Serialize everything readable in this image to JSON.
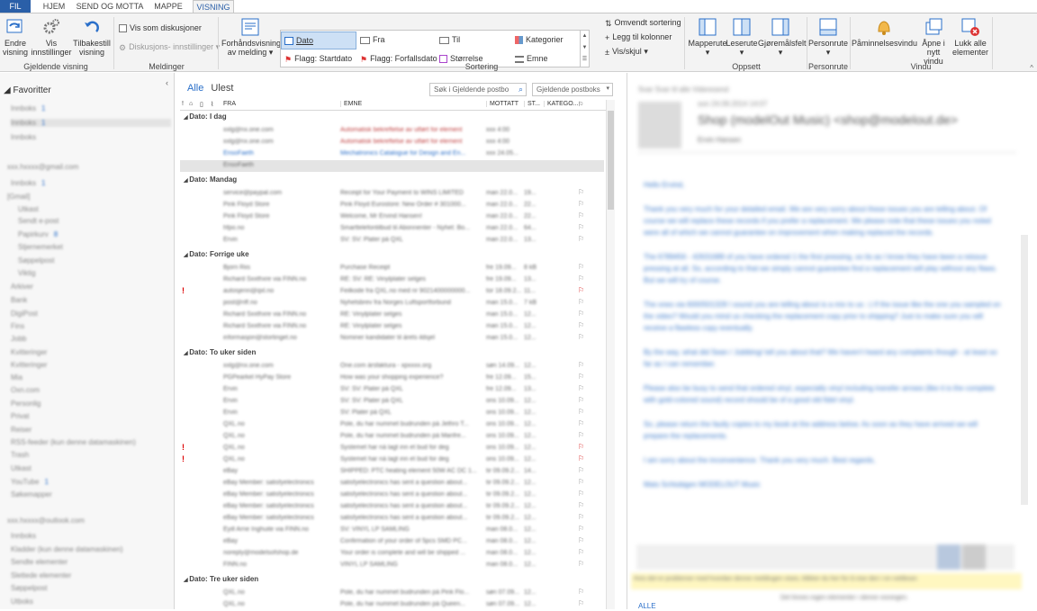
{
  "tabs": [
    "FIL",
    "HJEM",
    "SEND OG MOTTA",
    "MAPPE",
    "VISNING"
  ],
  "ribbon": {
    "change_view": "Endre visning",
    "view_settings": "Vis innstillinger",
    "reset_view": "Tilbakestill visning",
    "current_view_group": "Gjeldende visning",
    "show_conversations": "Vis som diskusjoner",
    "conversation_settings": "Diskusjons- innstillinger",
    "messages_group": "Meldinger",
    "preview": "Forhåndsvisning av melding",
    "arr_date": "Dato",
    "arr_from": "Fra",
    "arr_to": "Til",
    "arr_categories": "Kategorier",
    "arr_flag_start": "Flagg: Startdato",
    "arr_flag_due": "Flagg: Forfallsdato",
    "arr_size": "Størrelse",
    "arr_subject": "Emne",
    "reverse_sort": "Omvendt sortering",
    "add_columns": "Legg til kolonner",
    "expand_collapse": "Vis/skjul",
    "arrangement_group": "Sortering",
    "folder_pane": "Mapperute",
    "reading_pane": "Leserute",
    "todo_bar": "Gjøremålsfelt",
    "layout_group": "Oppsett",
    "people_pane": "Personrute",
    "people_group": "Personrute",
    "reminders": "Påminnelsesvindu",
    "open_new": "Åpne i nytt vindu",
    "close_all": "Lukk alle elementer",
    "window_group": "Vindu"
  },
  "nav": {
    "favorites": "Favoritter",
    "items": [
      {
        "t": "Innboks",
        "c": "1",
        "blue": false
      },
      {
        "t": "Innboks",
        "c": "1",
        "blue": false
      },
      {
        "t": "Innboks",
        "c": "",
        "blue": false
      },
      {
        "t": "xxx.hxxxx@gmail.com",
        "c": "",
        "blue": false
      },
      {
        "t": "Innboks",
        "c": "1",
        "blue": false
      },
      {
        "t": "[Gmail]",
        "c": "",
        "blue": false
      },
      {
        "t": "Utkast",
        "c": "",
        "blue": false
      },
      {
        "t": "Sendt e-post",
        "c": "",
        "blue": false
      },
      {
        "t": "Papirkurv",
        "c": "8",
        "blue": false
      },
      {
        "t": "Stjernemerket",
        "c": "",
        "blue": false
      },
      {
        "t": "Søppelpost",
        "c": "",
        "blue": false
      },
      {
        "t": "Viktig",
        "c": "",
        "blue": false
      },
      {
        "t": "Arkiver",
        "c": "",
        "blue": false
      },
      {
        "t": "Bank",
        "c": "",
        "blue": false
      },
      {
        "t": "DigiPost",
        "c": "",
        "blue": false
      },
      {
        "t": "Fins",
        "c": "",
        "blue": false
      },
      {
        "t": "Jobb",
        "c": "",
        "blue": false
      },
      {
        "t": "Kvitteringer",
        "c": "",
        "blue": false
      },
      {
        "t": "Kvitteringer",
        "c": "",
        "blue": false
      },
      {
        "t": "Mia",
        "c": "",
        "blue": false
      },
      {
        "t": "Oxn.com",
        "c": "",
        "blue": false
      },
      {
        "t": "Personlig",
        "c": "",
        "blue": false
      },
      {
        "t": "Privat",
        "c": "",
        "blue": false
      },
      {
        "t": "Reiser",
        "c": "",
        "blue": false
      },
      {
        "t": "RSS-feeder (kun denne datamaskinen)",
        "c": "",
        "blue": false
      },
      {
        "t": "Trash",
        "c": "",
        "blue": false
      },
      {
        "t": "Utkast",
        "c": "",
        "blue": false
      },
      {
        "t": "YouTube",
        "c": "1",
        "blue": false
      },
      {
        "t": "Søkemapper",
        "c": "",
        "blue": false
      },
      {
        "t": "xxx.hxxxx@outlook.com",
        "c": "",
        "blue": false
      },
      {
        "t": "Innboks",
        "c": "",
        "blue": false
      },
      {
        "t": "Kladder (kun denne datamaskinen)",
        "c": "",
        "blue": false
      },
      {
        "t": "Sendte elementer",
        "c": "",
        "blue": false
      },
      {
        "t": "Slettede elementer",
        "c": "",
        "blue": false
      },
      {
        "t": "Søppelpost",
        "c": "",
        "blue": false
      },
      {
        "t": "Utboks",
        "c": "",
        "blue": false
      }
    ]
  },
  "list": {
    "filter_all": "Alle",
    "filter_unread": "Ulest",
    "search_placeholder": "Søk i Gjeldende postbo",
    "scope": "Gjeldende postboks",
    "col_from": "FRA",
    "col_subject": "EMNE",
    "col_received": "MOTTATT",
    "col_size": "ST...",
    "col_cat": "KATEGO..."
  },
  "groups": [
    {
      "title": "Dato: I dag",
      "rows": [
        {
          "from": "xxlg@nx.one.com",
          "subj": "Automatisk bekreftelse av utført for element",
          "date": "xxx 4:00",
          "size": "",
          "imp": false,
          "flag": false,
          "blue": false
        },
        {
          "from": "xxlg@nx.one.com",
          "subj": "Automatisk bekreftelse av utført for element",
          "date": "xxx 4:00",
          "size": "",
          "imp": false,
          "flag": false,
          "blue": false
        },
        {
          "from": "EnsoFaeth",
          "subj": "Mechatronics Catalogue for Design and En...",
          "date": "xxx 24.05...",
          "size": "",
          "imp": false,
          "flag": false,
          "blue": true
        },
        {
          "from": "EnsoFaeth",
          "subj": "",
          "date": "",
          "size": "",
          "imp": false,
          "flag": false,
          "blue": false,
          "sel": true
        }
      ]
    },
    {
      "title": "Dato: Mandag",
      "rows": [
        {
          "from": "service@paypal.com",
          "subj": "Receipt for Your Payment to WINS LIMITED",
          "date": "man 22.0...",
          "size": "19...",
          "imp": false,
          "flag": true
        },
        {
          "from": "Pink Floyd Store",
          "subj": "Pink Floyd Eurostore: New Order # 301000...",
          "date": "man 22.0...",
          "size": "22...",
          "imp": false,
          "flag": true
        },
        {
          "from": "Pink Floyd Store",
          "subj": "Welcome, Mr Ervind Hansen!",
          "date": "man 22.0...",
          "size": "22...",
          "imp": false,
          "flag": true
        },
        {
          "from": "hfpo.no",
          "subj": "Smarttelefontilbud til Abonnenter - Nyhet: Bo...",
          "date": "man 22.0...",
          "size": "64...",
          "imp": false,
          "flag": true
        },
        {
          "from": "Ervin",
          "subj": "SV: SV: Plater på QXL",
          "date": "man 22.0...",
          "size": "13...",
          "imp": false,
          "flag": true
        }
      ]
    },
    {
      "title": "Dato: Forrige uke",
      "rows": [
        {
          "from": "Bjorn Riis",
          "subj": "Purchase Receipt",
          "date": "fre 19.09...",
          "size": "8 kB",
          "imp": false,
          "flag": true
        },
        {
          "from": "Richard Sxxthxre via FINN.no",
          "subj": "RE: SV: RE: Vinylplater selges",
          "date": "fre 19.09...",
          "size": "13...",
          "imp": false,
          "flag": true
        },
        {
          "from": "autosjenn@qxl.no",
          "subj": "Feilkode fra QXL.no med nr 9021400000000...",
          "date": "tor 18.09.2...",
          "size": "11...",
          "imp": true,
          "flag": true
        },
        {
          "from": "post@nff.no",
          "subj": "Nyhetsbrev fra Norges Luftsportforbund",
          "date": "man 15.0...",
          "size": "7 kB",
          "imp": false,
          "flag": true
        },
        {
          "from": "Richard Sxxthxre via FINN.no",
          "subj": "RE: Vinylplater selges",
          "date": "man 15.0...",
          "size": "12...",
          "imp": false,
          "flag": true
        },
        {
          "from": "Richard Sxxthxre via FINN.no",
          "subj": "RE: Vinylplater selges",
          "date": "man 15.0...",
          "size": "12...",
          "imp": false,
          "flag": true
        },
        {
          "from": "informasjon@stortinget.no",
          "subj": "Nominer kandidater til årets ildsjel",
          "date": "man 15.0...",
          "size": "12...",
          "imp": false,
          "flag": true
        }
      ]
    },
    {
      "title": "Dato: To uker siden",
      "rows": [
        {
          "from": "xxlg@nx.one.com",
          "subj": "One.com årsfaktura - xpxxxx.org",
          "date": "søn 14.09...",
          "size": "12...",
          "imp": false,
          "flag": true
        },
        {
          "from": "PGPearkel HyPay Store",
          "subj": "How was your shopping experience?",
          "date": "fre 12.09...",
          "size": "15...",
          "imp": false,
          "flag": true
        },
        {
          "from": "Ervin",
          "subj": "SV: SV: Plater på QXL",
          "date": "fre 12.09...",
          "size": "13...",
          "imp": false,
          "flag": true
        },
        {
          "from": "Ervin",
          "subj": "SV: SV: Plater på QXL",
          "date": "ons 10.09...",
          "size": "12...",
          "imp": false,
          "flag": true
        },
        {
          "from": "Ervin",
          "subj": "SV: Plater på QXL",
          "date": "ons 10.09...",
          "size": "12...",
          "imp": false,
          "flag": true
        },
        {
          "from": "QXL.no",
          "subj": "Pole, du har nummet budrunden på Jethro T...",
          "date": "ons 10.09...",
          "size": "12...",
          "imp": false,
          "flag": true
        },
        {
          "from": "QXL.no",
          "subj": "Pole, du har nummet budrunden på Manfre...",
          "date": "ons 10.09...",
          "size": "12...",
          "imp": false,
          "flag": true
        },
        {
          "from": "QXL.no",
          "subj": "Systemet har nå lagt inn et bud for deg",
          "date": "ons 10.09...",
          "size": "12...",
          "imp": true,
          "flag": true
        },
        {
          "from": "QXL.no",
          "subj": "Systemet har nå lagt inn et bud for deg",
          "date": "ons 10.09...",
          "size": "12...",
          "imp": true,
          "flag": true
        },
        {
          "from": "eBay",
          "subj": "SHIPPED: PTC heating element 50W AC DC 1...",
          "date": "tir 09.09.2...",
          "size": "14...",
          "imp": false,
          "flag": true
        },
        {
          "from": "eBay Member: satisfyelectronics",
          "subj": "satisfyelectronics has sent a question about...",
          "date": "tir 09.09.2...",
          "size": "12...",
          "imp": false,
          "flag": true
        },
        {
          "from": "eBay Member: satisfyelectronics",
          "subj": "satisfyelectronics has sent a question about...",
          "date": "tir 09.09.2...",
          "size": "12...",
          "imp": false,
          "flag": true
        },
        {
          "from": "eBay Member: satisfyelectronics",
          "subj": "satisfyelectronics has sent a question about...",
          "date": "tir 09.09.2...",
          "size": "12...",
          "imp": false,
          "flag": true
        },
        {
          "from": "eBay Member: satisfyelectronics",
          "subj": "satisfyelectronics has sent a question about...",
          "date": "tir 09.09.2...",
          "size": "12...",
          "imp": false,
          "flag": true
        },
        {
          "from": "Eyill Arne Inghuite via FINN.no",
          "subj": "SV: VINYL LP SAMLING",
          "date": "man 08.0...",
          "size": "12...",
          "imp": false,
          "flag": true
        },
        {
          "from": "eBay",
          "subj": "Confirmation of your order of 5pcs SMD PC...",
          "date": "man 08.0...",
          "size": "12...",
          "imp": false,
          "flag": true
        },
        {
          "from": "noreply@modelsofshop.de",
          "subj": "Your order is complete and will be shipped ...",
          "date": "man 08.0...",
          "size": "12...",
          "imp": false,
          "flag": true
        },
        {
          "from": "FINN.no",
          "subj": "VINYL LP SAMLING",
          "date": "man 08.0...",
          "size": "12...",
          "imp": false,
          "flag": true
        }
      ]
    },
    {
      "title": "Dato: Tre uker siden",
      "rows": [
        {
          "from": "QXL.no",
          "subj": "Pole, du har nummet budrunden på Pink Flo...",
          "date": "søn 07.09...",
          "size": "12...",
          "imp": false,
          "flag": true
        },
        {
          "from": "QXL.no",
          "subj": "Pole, du har nummet budrunden på Queen...",
          "date": "søn 07.09...",
          "size": "12...",
          "imp": false,
          "flag": true
        }
      ]
    }
  ],
  "reading": {
    "actions": "Svar   Svar til alle   Videresend",
    "date": "son 24.09.2014 14:07",
    "sender": "Shop (modelOut Music) <shop@modelout.de>",
    "to": "Ervin Hansen",
    "greeting": "Hello Ervind,",
    "p1": "Thank you very much for your detailed email. We are very sorry about these issues you are telling about. Of course we will replace these records if you prefer a replacement. We please note that these issues you noted were all of which we cannot guarantee on improvement when making replaced the records.",
    "p2": "The 6789456 - 42631689 of you have ordered 1 the first pressing, so its as I know they have been a reissue pressing at all. So, according to that we simply cannot guarantee find a replacement will play without any flaws. But we will try of course.",
    "p3": "The ones via 6000501328 I sound you are telling about is a mix to us :-) If the issue like the one you sampled on the video? Would you mind us checking the replacement copy prior to shipping? Just to make sure you will receive a flawless copy eventually.",
    "p4": "By the way, what did Sean / Jubibing/ tell you about that? We haven't heard any complaints though - at least so far as I can remember.",
    "p5": "Please also be busy to send that ordered vinyl, especially vinyl including transfer arrows (like it is the complete with gold-colored sound) record should be of a good old fidel vinyl.",
    "p6": "So, please return the faulty copies to my book at the address below. As soon as they have arrived we will prepare the replacements.",
    "p7": "I am sorry about the inconvenience. Thank you very much. Best regards,",
    "sig": "Mats Schlubigen  MODELOUT Music",
    "infobar": "Hvis det er problemer med hvordan denne meldingen vises, klikker du her for å vise den i en nettleser.",
    "footer": "Det finnes ingen elementer i denne visningen.",
    "all": "ALLE"
  }
}
